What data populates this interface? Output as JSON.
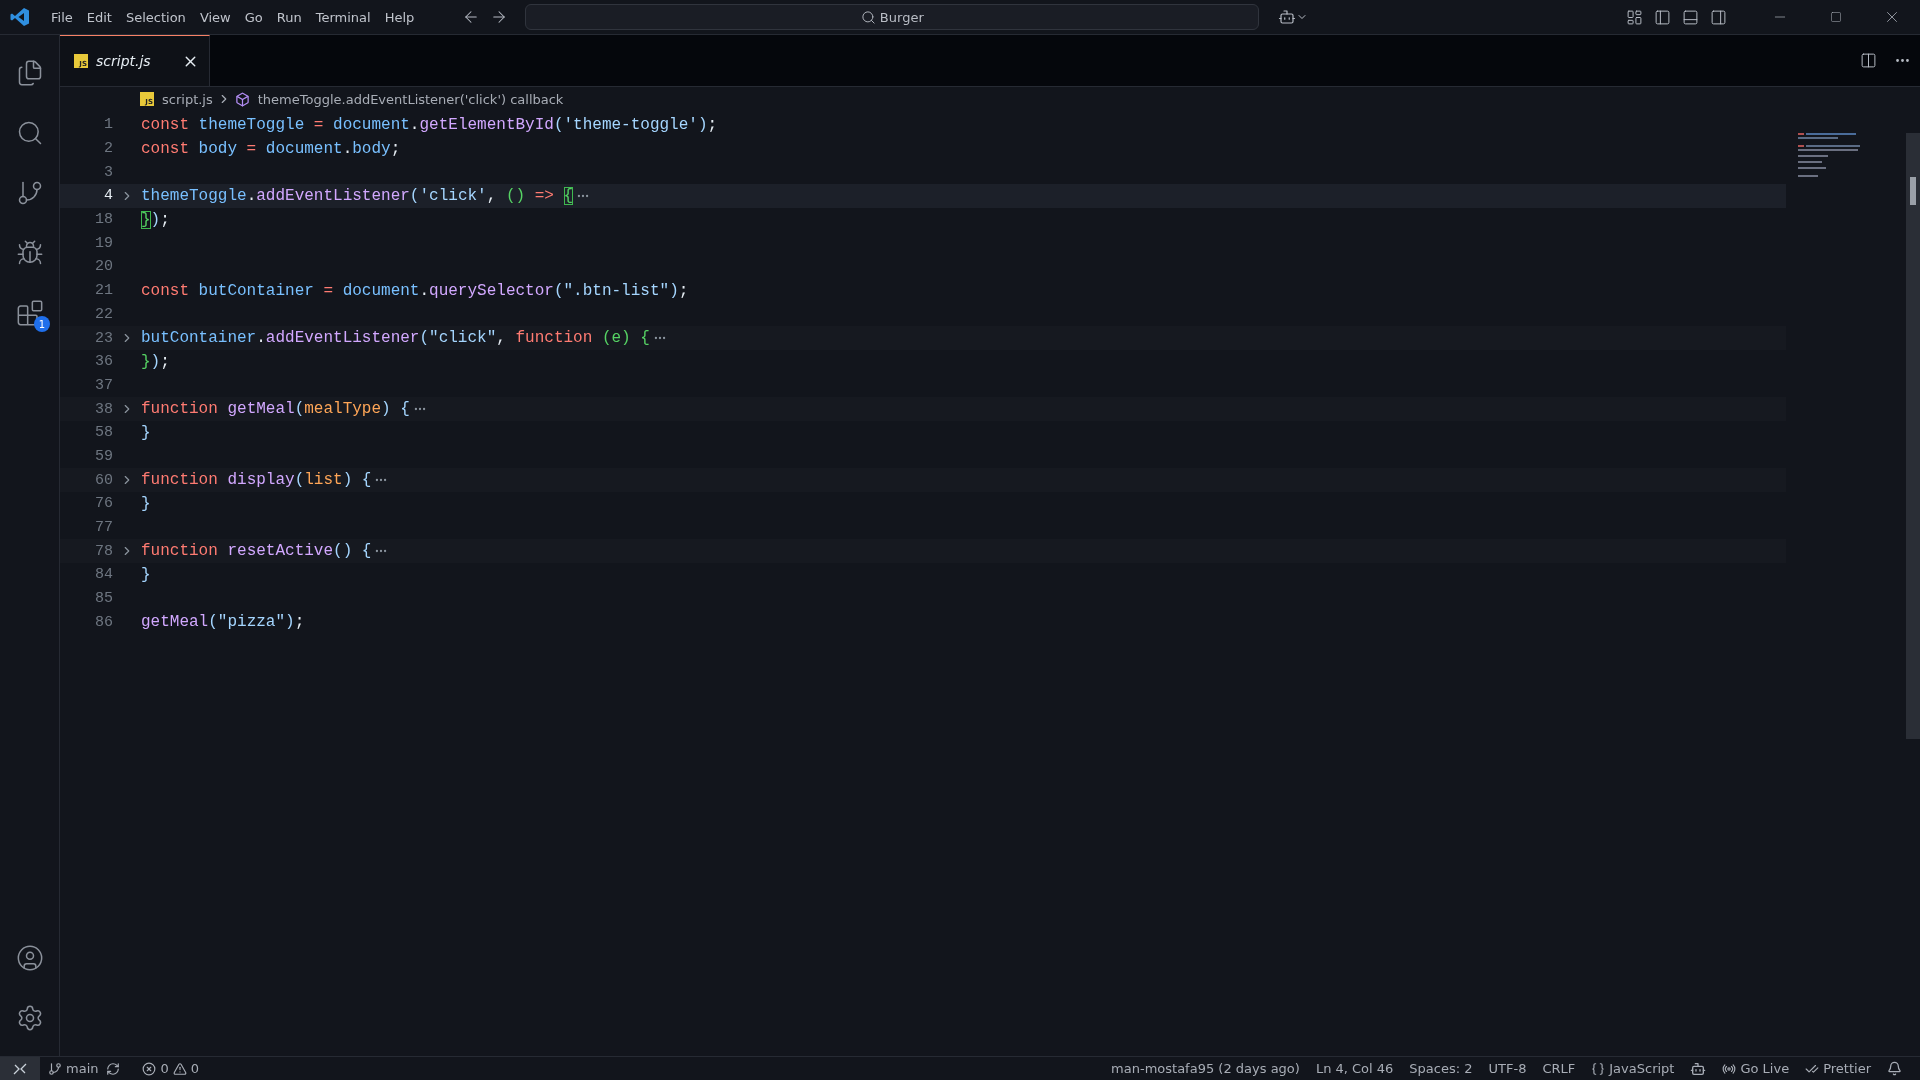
{
  "menu": [
    "File",
    "Edit",
    "Selection",
    "View",
    "Go",
    "Run",
    "Terminal",
    "Help"
  ],
  "command_center": {
    "value": "Burger"
  },
  "activity_bar": {
    "top": [
      {
        "kind": "explorer"
      },
      {
        "kind": "search"
      },
      {
        "kind": "source_control"
      },
      {
        "kind": "run"
      },
      {
        "kind": "extensions",
        "badge": "1"
      }
    ],
    "bottom": [
      {
        "kind": "account"
      },
      {
        "kind": "settings"
      }
    ]
  },
  "tabs": [
    {
      "label": "script.js",
      "icon_label": "JS",
      "selected": true,
      "preview": true
    }
  ],
  "breadcrumbs": [
    {
      "kind": "file",
      "label": "script.js",
      "icon_label": "JS"
    },
    {
      "kind": "symbol",
      "label": "themeToggle.addEventListener('click') callback"
    }
  ],
  "editor": {
    "lines": [
      {
        "number": "1",
        "folded": false,
        "current": false,
        "tokens": [
          {
            "kind": "kw",
            "text": "const "
          },
          {
            "kind": "var",
            "text": "themeToggle"
          },
          {
            "kind": "op",
            "text": " = "
          },
          {
            "kind": "var",
            "text": "document"
          },
          {
            "kind": "p",
            "text": "."
          },
          {
            "kind": "fn",
            "text": "getElementById"
          },
          {
            "kind": "b1",
            "text": "("
          },
          {
            "kind": "str",
            "text": "'theme-toggle'"
          },
          {
            "kind": "b1",
            "text": ")"
          },
          {
            "kind": "p",
            "text": ";"
          }
        ]
      },
      {
        "number": "2",
        "folded": false,
        "current": false,
        "tokens": [
          {
            "kind": "kw",
            "text": "const "
          },
          {
            "kind": "var",
            "text": "body"
          },
          {
            "kind": "op",
            "text": " = "
          },
          {
            "kind": "var",
            "text": "document"
          },
          {
            "kind": "p",
            "text": "."
          },
          {
            "kind": "var",
            "text": "body"
          },
          {
            "kind": "p",
            "text": ";"
          }
        ]
      },
      {
        "number": "3",
        "folded": false,
        "current": false
      },
      {
        "number": "4",
        "folded": true,
        "current": true,
        "tokens": [
          {
            "kind": "var",
            "text": "themeToggle"
          },
          {
            "kind": "p",
            "text": "."
          },
          {
            "kind": "fn",
            "text": "addEventListener"
          },
          {
            "kind": "b1",
            "text": "("
          },
          {
            "kind": "str",
            "text": "'click'"
          },
          {
            "kind": "p",
            "text": ", "
          },
          {
            "kind": "b2",
            "text": "() "
          },
          {
            "kind": "op",
            "text": "=> "
          },
          {
            "kind": "match",
            "text": "{"
          }
        ]
      },
      {
        "number": "18",
        "folded": false,
        "current": false,
        "tokens": [
          {
            "kind": "match",
            "text": "}"
          },
          {
            "kind": "b1",
            "text": ")"
          },
          {
            "kind": "p",
            "text": ";"
          }
        ]
      },
      {
        "number": "19",
        "folded": false,
        "current": false
      },
      {
        "number": "20",
        "folded": false,
        "current": false
      },
      {
        "number": "21",
        "folded": false,
        "current": false,
        "tokens": [
          {
            "kind": "kw",
            "text": "const "
          },
          {
            "kind": "var",
            "text": "butContainer"
          },
          {
            "kind": "op",
            "text": " = "
          },
          {
            "kind": "var",
            "text": "document"
          },
          {
            "kind": "p",
            "text": "."
          },
          {
            "kind": "fn",
            "text": "querySelector"
          },
          {
            "kind": "b1",
            "text": "("
          },
          {
            "kind": "str",
            "text": "\".btn-list\""
          },
          {
            "kind": "b1",
            "text": ")"
          },
          {
            "kind": "p",
            "text": ";"
          }
        ]
      },
      {
        "number": "22",
        "folded": false,
        "current": false
      },
      {
        "number": "23",
        "folded": true,
        "current": false,
        "tokens": [
          {
            "kind": "var",
            "text": "butContainer"
          },
          {
            "kind": "p",
            "text": "."
          },
          {
            "kind": "fn",
            "text": "addEventListener"
          },
          {
            "kind": "b1",
            "text": "("
          },
          {
            "kind": "str",
            "text": "\"click\""
          },
          {
            "kind": "p",
            "text": ", "
          },
          {
            "kind": "kw",
            "text": "function "
          },
          {
            "kind": "b2",
            "text": "(e) "
          },
          {
            "kind": "b2",
            "text": "{"
          }
        ]
      },
      {
        "number": "36",
        "folded": false,
        "current": false,
        "tokens": [
          {
            "kind": "b2",
            "text": "}"
          },
          {
            "kind": "b1",
            "text": ")"
          },
          {
            "kind": "p",
            "text": ";"
          }
        ]
      },
      {
        "number": "37",
        "folded": false,
        "current": false
      },
      {
        "number": "38",
        "folded": true,
        "current": false,
        "tokens": [
          {
            "kind": "kw",
            "text": "function "
          },
          {
            "kind": "fn",
            "text": "getMeal"
          },
          {
            "kind": "b1",
            "text": "("
          },
          {
            "kind": "param",
            "text": "mealType"
          },
          {
            "kind": "b1",
            "text": ") {"
          }
        ]
      },
      {
        "number": "58",
        "folded": false,
        "current": false,
        "tokens": [
          {
            "kind": "b1",
            "text": "}"
          }
        ]
      },
      {
        "number": "59",
        "folded": false,
        "current": false
      },
      {
        "number": "60",
        "folded": true,
        "current": false,
        "tokens": [
          {
            "kind": "kw",
            "text": "function "
          },
          {
            "kind": "fn",
            "text": "display"
          },
          {
            "kind": "b1",
            "text": "("
          },
          {
            "kind": "param",
            "text": "list"
          },
          {
            "kind": "b1",
            "text": ") {"
          }
        ]
      },
      {
        "number": "76",
        "folded": false,
        "current": false,
        "tokens": [
          {
            "kind": "b1",
            "text": "}"
          }
        ]
      },
      {
        "number": "77",
        "folded": false,
        "current": false
      },
      {
        "number": "78",
        "folded": true,
        "current": false,
        "tokens": [
          {
            "kind": "kw",
            "text": "function "
          },
          {
            "kind": "fn",
            "text": "resetActive"
          },
          {
            "kind": "b1",
            "text": "() {"
          }
        ]
      },
      {
        "number": "84",
        "folded": false,
        "current": false,
        "tokens": [
          {
            "kind": "b1",
            "text": "}"
          }
        ]
      },
      {
        "number": "85",
        "folded": false,
        "current": false
      },
      {
        "number": "86",
        "folded": false,
        "current": false,
        "tokens": [
          {
            "kind": "fn",
            "text": "getMeal"
          },
          {
            "kind": "b1",
            "text": "("
          },
          {
            "kind": "str",
            "text": "\"pizza\""
          },
          {
            "kind": "b1",
            "text": ")"
          },
          {
            "kind": "p",
            "text": ";"
          }
        ]
      }
    ]
  },
  "status_bar": {
    "branch": "main",
    "errors": "0",
    "warnings": "0",
    "blame": "man-mostafa95 (2 days ago)",
    "position": "Ln 4, Col 46",
    "indent": "Spaces: 2",
    "encoding": "UTF-8",
    "eol": "CRLF",
    "language": "JavaScript",
    "live": "Go Live",
    "formatter": "Prettier"
  }
}
